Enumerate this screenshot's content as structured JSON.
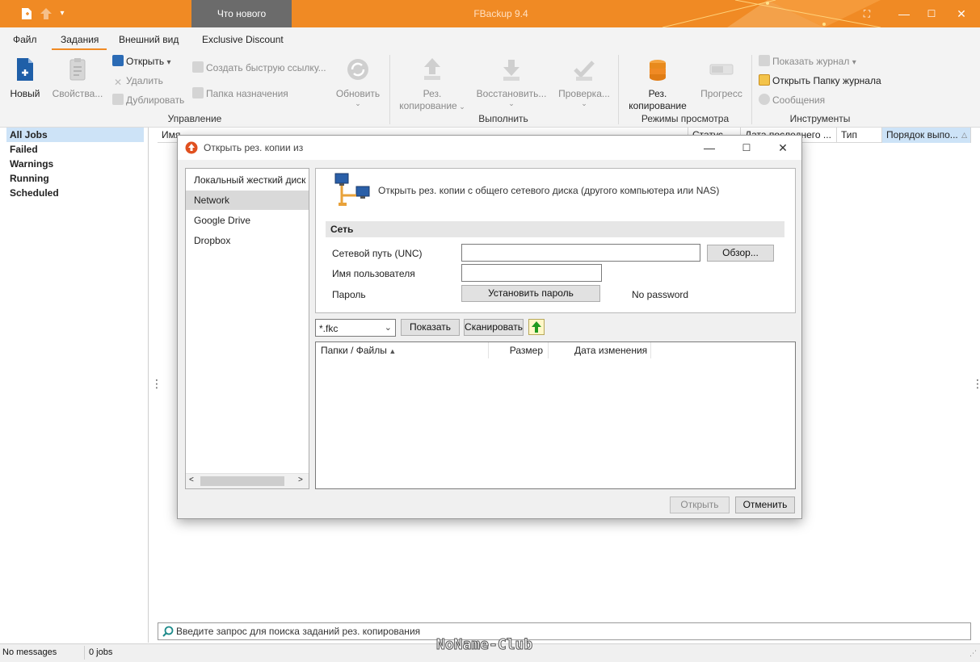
{
  "titlebar": {
    "app_title": "FBackup 9.4",
    "whats_new": "Что нового",
    "min": "—",
    "max": "☐",
    "close": "✕"
  },
  "menu": {
    "tabs": [
      "Файл",
      "Задания",
      "Внешний вид",
      "Exclusive Discount"
    ]
  },
  "ribbon": {
    "new": "Новый",
    "props": "Свойства...",
    "open": "Открыть",
    "delete": "Удалить",
    "duplicate": "Дублировать",
    "quicklink": "Создать быструю ссылку...",
    "dest_folder": "Папка назначения",
    "refresh": "Обновить",
    "backup_l1": "Рез.",
    "backup_l2": "копирование",
    "restore": "Восстановить...",
    "check": "Проверка...",
    "view_backup_l1": "Рез.",
    "view_backup_l2": "копирование",
    "progress": "Прогресс",
    "show_log": "Показать журнал",
    "open_log_folder": "Открыть Папку журнала",
    "messages": "Сообщения",
    "group_manage": "Управление",
    "group_run": "Выполнить",
    "group_view": "Режимы просмотра",
    "group_tools": "Инструменты"
  },
  "leftpanel": {
    "items": [
      "All Jobs",
      "Failed",
      "Warnings",
      "Running",
      "Scheduled"
    ]
  },
  "grid": {
    "columns": [
      "Имя",
      "Статус",
      "Дата последнего ...",
      "Тип",
      "Порядок выпо..."
    ]
  },
  "dialog": {
    "title": "Открыть рез. копии из",
    "sources": [
      "Локальный жесткий диск",
      "Network",
      "Google Drive",
      "Dropbox"
    ],
    "description": "Открыть рез. копии с общего сетевого диска (другого компьютера или NAS)",
    "section": "Сеть",
    "unc_label": "Сетевой путь (UNC)",
    "user_label": "Имя пользователя",
    "pass_label": "Пароль",
    "unc_value": "",
    "user_value": "",
    "browse": "Обзор...",
    "set_password": "Установить пароль",
    "no_password": "No password",
    "filter": "*.fkc",
    "show": "Показать",
    "scan": "Сканировать",
    "file_columns": [
      "Папки / Файлы",
      "Размер",
      "Дата изменения"
    ],
    "open_btn": "Открыть",
    "cancel_btn": "Отменить"
  },
  "search": {
    "placeholder": "Введите запрос для поиска заданий рез. копирования"
  },
  "status": {
    "messages": "No messages",
    "jobs": "0 jobs"
  },
  "watermark": "NoName-Club",
  "colors": {
    "accent": "#f08a24",
    "selection": "#cde3f7"
  }
}
